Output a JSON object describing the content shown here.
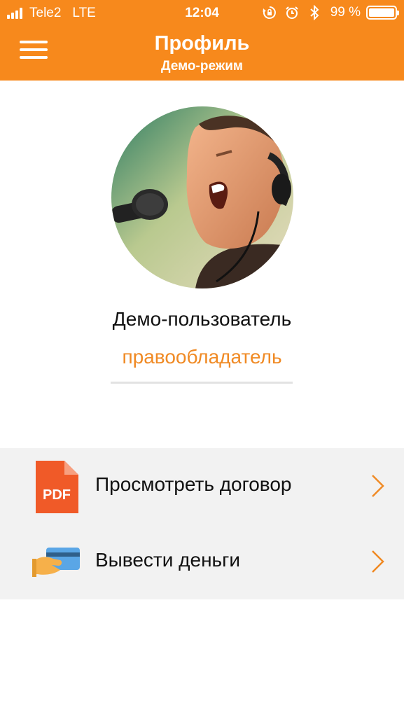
{
  "status_bar": {
    "carrier": "Tele2",
    "network": "LTE",
    "time": "12:04",
    "battery_percent": "99 %",
    "battery_level": 0.99,
    "icons": [
      "signal-icon",
      "rotation-lock-icon",
      "alarm-icon",
      "bluetooth-icon",
      "battery-icon"
    ]
  },
  "header": {
    "title": "Профиль",
    "subtitle": "Демо-режим",
    "menu_icon": "hamburger-menu-icon"
  },
  "profile": {
    "name": "Демо-пользователь",
    "role": "правообладатель",
    "avatar": "avatar-photo"
  },
  "menu": {
    "items": [
      {
        "label": "Просмотреть договор",
        "icon": "pdf-file-icon"
      },
      {
        "label": "Вывести деньги",
        "icon": "card-payment-icon"
      }
    ],
    "chevron_icon": "chevron-right-icon"
  },
  "colors": {
    "accent": "#f7891c",
    "role_text": "#f08a24",
    "list_background": "#f2f2f2",
    "pdf_red": "#f05a28",
    "chevron": "#f08a24"
  }
}
